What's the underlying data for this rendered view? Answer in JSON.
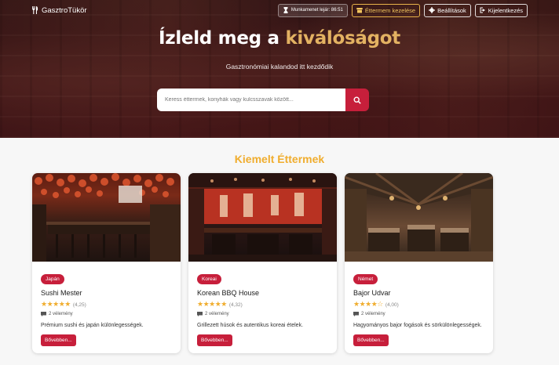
{
  "navbar": {
    "brand": "GasztroTükör",
    "session_label": "Munkamenet lejár: 86:51",
    "manage_label": "Éttermem kezelése",
    "settings_label": "Beállítások",
    "logout_label": "Kijelentkezés"
  },
  "hero": {
    "title_main": "Ízleld meg a ",
    "title_accent": "kiválóságot",
    "subtitle": "Gasztronómiai kalandod itt kezdődik",
    "search_placeholder": "Keress éttermek, konyhák vagy kulcsszavak között..."
  },
  "featured": {
    "title": "Kiemelt Éttermek",
    "restaurants": [
      {
        "cuisine": "Japán",
        "name": "Sushi Mester",
        "stars": "★★★★★",
        "rating": "(4,25)",
        "reviews": "2 vélemény",
        "description": "Prémium sushi és japán különlegességek.",
        "button": "Bővebben..."
      },
      {
        "cuisine": "Koreai",
        "name": "Korean BBQ House",
        "stars": "★★★★★",
        "rating": "(4,32)",
        "reviews": "2 vélemény",
        "description": "Grillezett húsok és autentikus koreai ételek.",
        "button": "Bővebben..."
      },
      {
        "cuisine": "Német",
        "name": "Bajor Udvar",
        "stars": "★★★★☆",
        "rating": "(4,00)",
        "reviews": "2 vélemény",
        "description": "Hagyományos bajor fogások és sörkülönlegességek.",
        "button": "Bővebben..."
      }
    ]
  },
  "colors": {
    "accent_red": "#c71f3b",
    "gold": "#f0ad2e"
  },
  "icons": {
    "brand": "utensils-icon",
    "session": "hourglass-icon",
    "manage": "store-icon",
    "settings": "gear-icon",
    "logout": "logout-icon",
    "search": "search-icon",
    "reviews": "comment-icon"
  }
}
